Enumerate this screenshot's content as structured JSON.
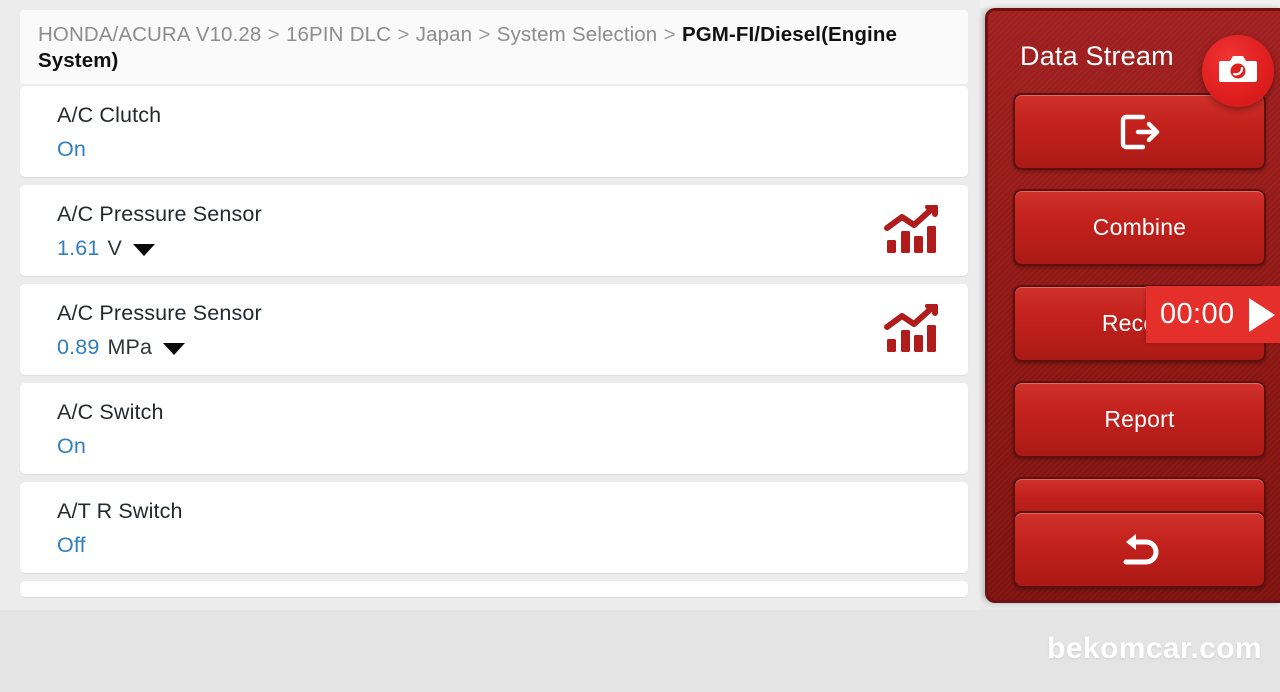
{
  "breadcrumb": {
    "trail": [
      "HONDA/ACURA V10.28",
      "16PIN DLC",
      "Japan",
      "System Selection"
    ],
    "current": "PGM-FI/Diesel(Engine System)",
    "separator": ">"
  },
  "stream_list": {
    "rows": [
      {
        "name": "A/C Clutch",
        "value": "On",
        "unit": "",
        "has_caret": false,
        "has_chart_icon": false
      },
      {
        "name": "A/C Pressure Sensor",
        "value": "1.61",
        "unit": "V",
        "has_caret": true,
        "has_chart_icon": true
      },
      {
        "name": "A/C Pressure Sensor",
        "value": "0.89",
        "unit": "MPa",
        "has_caret": true,
        "has_chart_icon": true
      },
      {
        "name": "A/C Switch",
        "value": "On",
        "unit": "",
        "has_caret": false,
        "has_chart_icon": false
      },
      {
        "name": "A/T R Switch",
        "value": "Off",
        "unit": "",
        "has_caret": false,
        "has_chart_icon": false
      }
    ]
  },
  "side_panel": {
    "title": "Data Stream",
    "buttons": {
      "exit": "",
      "combine": "Combine",
      "record": "Record",
      "report": "Report",
      "back": ""
    }
  },
  "record_overlay": {
    "time": "00:00"
  },
  "footer": {
    "watermark": "bekomcar.com"
  },
  "colors": {
    "panel_dark_red": "#8d1714",
    "button_red": "#c3211c",
    "fab_red": "#e01f1f",
    "overlay_red": "#e42f2b",
    "value_blue": "#2f7fc1",
    "chart_icon_red": "#b01c1c",
    "page_bg": "#ececec",
    "card_bg": "#ffffff",
    "breadcrumb_gray": "#8d8d8d"
  }
}
